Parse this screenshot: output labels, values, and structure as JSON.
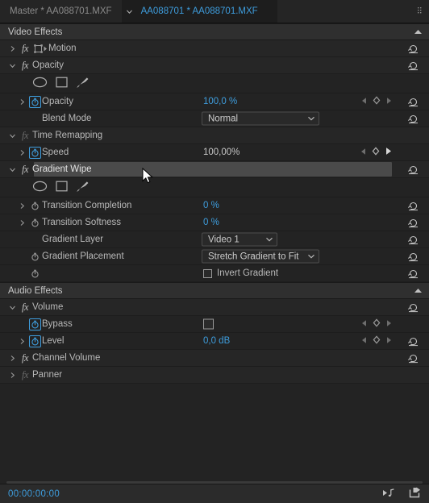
{
  "tabs": [
    {
      "label": "Master * AA088701.MXF",
      "active": false,
      "name": "tab-master"
    },
    {
      "label": "AA088701 * AA088701.MXF",
      "active": true,
      "name": "tab-clip"
    }
  ],
  "sections": {
    "video": {
      "title": "Video Effects",
      "collapse_icon": "triangle-up-icon"
    },
    "audio": {
      "title": "Audio Effects",
      "collapse_icon": "triangle-up-icon"
    }
  },
  "video_effects": [
    {
      "name": "Motion",
      "expanded": false
    },
    {
      "name": "Opacity",
      "expanded": true
    },
    {
      "name": "Time Remapping",
      "expanded": true
    },
    {
      "name": "Gradient Wipe",
      "expanded": true,
      "selected": true
    }
  ],
  "properties": {
    "opacity": {
      "label": "Opacity",
      "value": "100,0 %"
    },
    "blend_mode": {
      "label": "Blend Mode",
      "value": "Normal"
    },
    "speed": {
      "label": "Speed",
      "value": "100,00%"
    },
    "transition_completion": {
      "label": "Transition Completion",
      "value": "0 %"
    },
    "transition_softness": {
      "label": "Transition Softness",
      "value": "0 %"
    },
    "gradient_layer": {
      "label": "Gradient Layer",
      "value": "Video 1"
    },
    "gradient_placement": {
      "label": "Gradient Placement",
      "value": "Stretch Gradient to Fit"
    },
    "invert_gradient": {
      "label": "Invert Gradient",
      "checked": false
    },
    "bypass": {
      "label": "Bypass",
      "checked": false
    },
    "level": {
      "label": "Level",
      "value": "0,0 dB"
    }
  },
  "audio_effects": [
    {
      "name": "Volume",
      "expanded": true
    },
    {
      "name": "Channel Volume",
      "expanded": false
    },
    {
      "name": "Panner",
      "expanded": false
    }
  ],
  "mask_tools": [
    {
      "name": "create-ellipse-mask-icon"
    },
    {
      "name": "create-rectangle-mask-icon"
    },
    {
      "name": "free-draw-bezier-mask-icon"
    }
  ],
  "statusbar": {
    "timecode": "00:00:00:00",
    "icons": [
      "play-audio-icon",
      "export-frame-icon"
    ]
  },
  "colors": {
    "accent": "#3e9ddd",
    "panel_bg": "#232323",
    "header_bg": "#2f2f2f",
    "selection": "#4a4a4a"
  }
}
